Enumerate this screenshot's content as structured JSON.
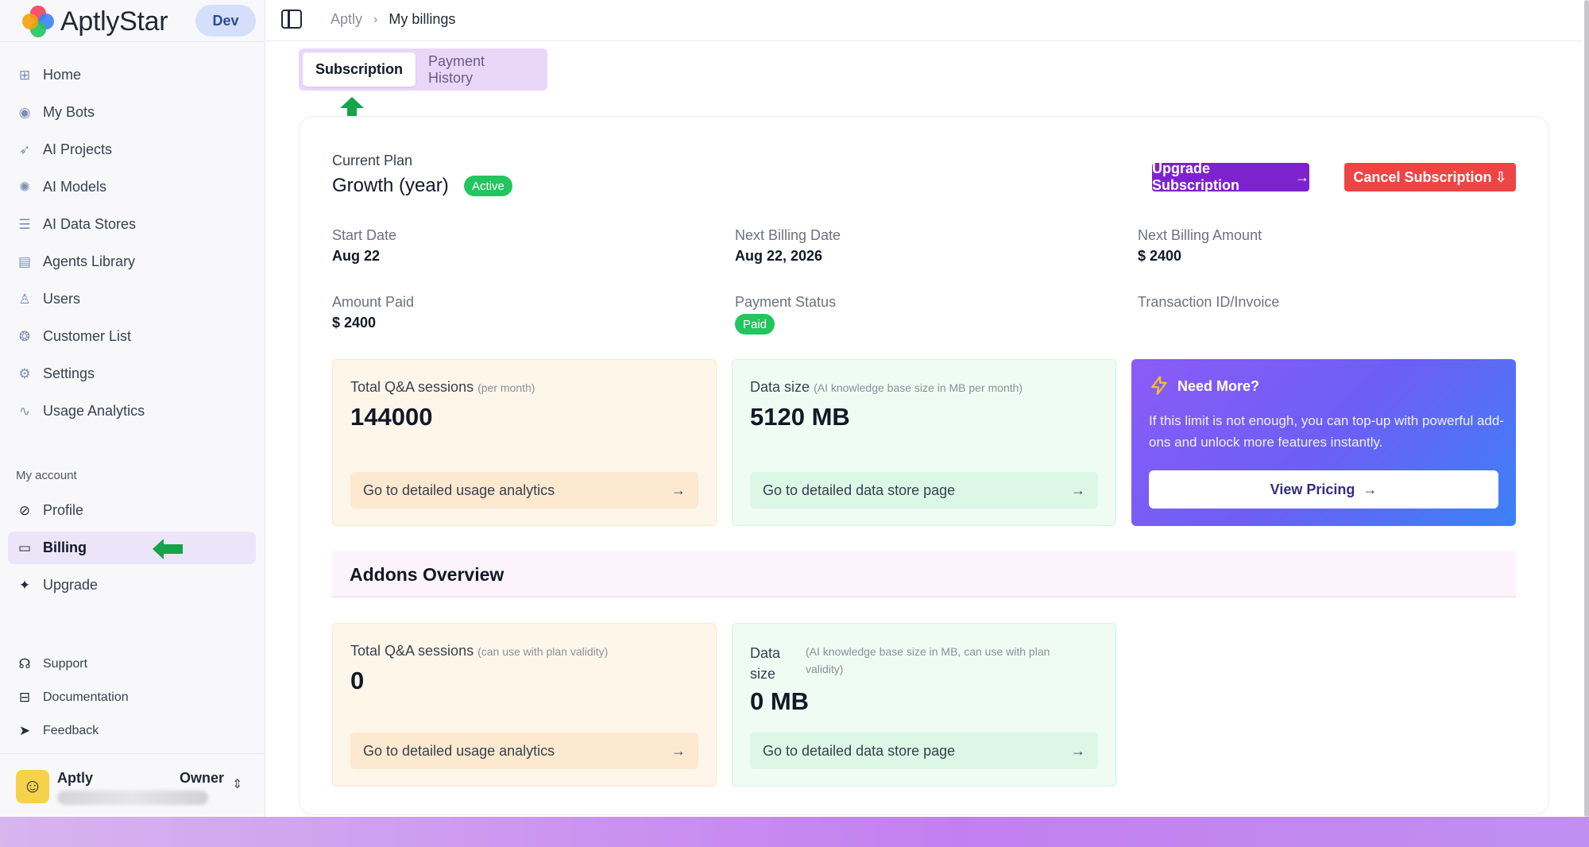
{
  "brand": {
    "name": "AptlyStar",
    "env_badge": "Dev"
  },
  "sidebar": {
    "items": [
      {
        "label": "Home",
        "icon": "home-icon"
      },
      {
        "label": "My Bots",
        "icon": "bot-icon"
      },
      {
        "label": "AI Projects",
        "icon": "rocket-icon"
      },
      {
        "label": "AI Models",
        "icon": "atom-icon"
      },
      {
        "label": "AI Data Stores",
        "icon": "database-icon"
      },
      {
        "label": "Agents Library",
        "icon": "library-icon"
      },
      {
        "label": "Users",
        "icon": "user-icon"
      },
      {
        "label": "Customer List",
        "icon": "users-icon"
      },
      {
        "label": "Settings",
        "icon": "gear-icon"
      },
      {
        "label": "Usage Analytics",
        "icon": "trend-icon"
      }
    ],
    "account_section": "My account",
    "account_items": [
      {
        "label": "Profile",
        "icon": "profile-icon"
      },
      {
        "label": "Billing",
        "icon": "card-icon",
        "active": true
      },
      {
        "label": "Upgrade",
        "icon": "sparkle-icon"
      }
    ],
    "footer_items": [
      {
        "label": "Support",
        "icon": "headset-icon"
      },
      {
        "label": "Documentation",
        "icon": "book-icon"
      },
      {
        "label": "Feedback",
        "icon": "send-icon"
      }
    ],
    "user": {
      "name": "Aptly",
      "role": "Owner"
    }
  },
  "breadcrumb": {
    "root": "Aptly",
    "current": "My billings"
  },
  "tabs": [
    {
      "label": "Subscription",
      "active": true
    },
    {
      "label": "Payment History",
      "active": false
    }
  ],
  "subscription": {
    "current_plan_label": "Current Plan",
    "plan_name": "Growth (year)",
    "status_badge": "Active",
    "upgrade_button": "Upgrade Subscription",
    "cancel_button": "Cancel Subscription",
    "fields": {
      "start_date_label": "Start Date",
      "start_date": "Aug 22",
      "next_billing_date_label": "Next Billing Date",
      "next_billing_date": "Aug 22, 2026",
      "next_billing_amount_label": "Next Billing Amount",
      "next_billing_amount": "$ 2400",
      "amount_paid_label": "Amount Paid",
      "amount_paid": "$ 2400",
      "payment_status_label": "Payment Status",
      "payment_status": "Paid",
      "transaction_label": "Transaction ID/Invoice"
    }
  },
  "usage": {
    "qa_title": "Total Q&A sessions",
    "qa_note": "(per month)",
    "qa_value": "144000",
    "qa_link": "Go to detailed usage analytics",
    "data_title": "Data size",
    "data_note": "(AI knowledge base size in MB per month)",
    "data_value": "5120 MB",
    "data_link": "Go to detailed data store page"
  },
  "need_more": {
    "title": "Need More?",
    "text": "If this limit is not enough, you can top-up with powerful add-ons and unlock more features instantly.",
    "button": "View Pricing"
  },
  "addons": {
    "title": "Addons Overview",
    "qa_title": "Total Q&A sessions",
    "qa_note": "(can use with plan validity)",
    "qa_value": "0",
    "qa_link": "Go to detailed usage analytics",
    "data_title": "Data size",
    "data_note": "(AI knowledge base size in MB, can use with plan validity)",
    "data_value": "0 MB",
    "data_link": "Go to detailed data store page"
  },
  "colors": {
    "accent_purple": "#7e22ce",
    "danger_red": "#ef4444",
    "success_green": "#22c55e",
    "annotation_arrow": "#16a34a"
  }
}
